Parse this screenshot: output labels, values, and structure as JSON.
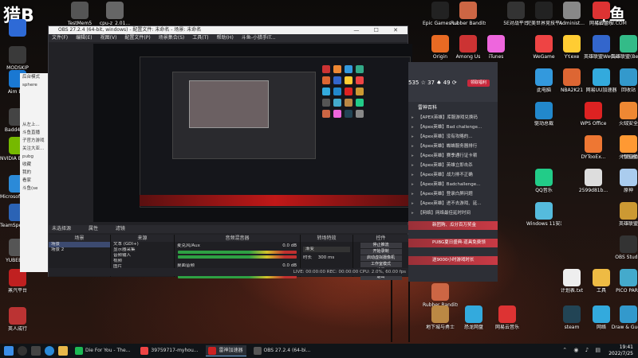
{
  "watermark": {
    "left": "猎B",
    "right": "斗鱼",
    "right_sub": "DOUYU.COM"
  },
  "left_icons_col1": [
    {
      "label": "",
      "color": "#2e6ad6"
    },
    {
      "label": "MODSKIP",
      "color": "#3a3a3a"
    },
    {
      "label": "Aim Lab",
      "color": "#1a78d2"
    },
    {
      "label": "Badd4Ko...",
      "color": "#444"
    },
    {
      "label": "NVIDIA Broadcast",
      "color": "#76b900"
    },
    {
      "label": "Microsoft Edge",
      "color": "#2b8ad8"
    },
    {
      "label": "TeamSpeak 3 Client",
      "color": "#2b63b5"
    },
    {
      "label": "YUBEBR...",
      "color": "#555"
    },
    {
      "label": "蒸汽平台",
      "color": "#c02020"
    },
    {
      "label": "英人成行",
      "color": "#b33"
    }
  ],
  "top_icons": [
    {
      "label": "TestMem5",
      "color": "#555"
    },
    {
      "label": "cpu-z_2.01...",
      "color": "#666"
    }
  ],
  "right_top_icons": [
    {
      "label": "Epic Games Launcher",
      "color": "#222"
    },
    {
      "label": "Rubber Bandits...",
      "color": "#c64"
    },
    {
      "label": "5E对战平台",
      "color": "#333"
    },
    {
      "label": "完美世界竞技平台",
      "color": "#222"
    },
    {
      "label": "Administ...",
      "color": "#888"
    },
    {
      "label": "网易云音乐",
      "color": "#d33"
    },
    {
      "label": "Origin",
      "color": "#e86a23"
    },
    {
      "label": "Among Us",
      "color": "#c33"
    },
    {
      "label": "iTunes",
      "color": "#e6d"
    },
    {
      "label": "WeGame",
      "color": "#e44"
    },
    {
      "label": "YY.exe",
      "color": "#fc3"
    },
    {
      "label": "英雄联盟WeGame版",
      "color": "#36c"
    },
    {
      "label": "英雄联盟(Beta版)",
      "color": "#3b8"
    },
    {
      "label": "此电脑",
      "color": "#39d"
    },
    {
      "label": "NBA2K21",
      "color": "#d63"
    },
    {
      "label": "网易UU加速器",
      "color": "#3ad"
    },
    {
      "label": "回收站",
      "color": "#39c"
    },
    {
      "label": "驱动总裁",
      "color": "#28c"
    },
    {
      "label": "WPS Office",
      "color": "#d22"
    },
    {
      "label": "火绒安全",
      "color": "#e83"
    },
    {
      "label": "火星直播",
      "color": "#d44"
    },
    {
      "label": "DYTooEx...",
      "color": "#e73"
    },
    {
      "label": "代练通",
      "color": "#f93"
    },
    {
      "label": "QQ音乐",
      "color": "#2c8"
    },
    {
      "label": "2599d81b...",
      "color": "#ddd"
    },
    {
      "label": "原神",
      "color": "#ace"
    },
    {
      "label": "Windows 11安装...",
      "color": "#5bd"
    },
    {
      "label": "英雄联盟",
      "color": "#c93"
    },
    {
      "label": "OBS Studio",
      "color": "#333"
    },
    {
      "label": "计划表.txt",
      "color": "#eee"
    },
    {
      "label": "工具",
      "color": "#eb4"
    },
    {
      "label": "PICO PARK",
      "color": "#4ac"
    },
    {
      "label": "steam",
      "color": "#245"
    },
    {
      "label": "网络",
      "color": "#3ad"
    },
    {
      "label": "Draw & Guess",
      "color": "#39c"
    },
    {
      "label": "Rubber Bandits...",
      "color": "#c64"
    },
    {
      "label": "地下城与勇士",
      "color": "#b84"
    },
    {
      "label": "恐龙网盘",
      "color": "#3ad"
    },
    {
      "label": "网易云音乐",
      "color": "#d33"
    }
  ],
  "left_app": {
    "rows": [
      "后台模式",
      "sphere",
      "",
      "",
      "",
      "",
      "从左上...",
      "斗鱼直播",
      "子官方游戏",
      "关注大亚...",
      "pubg",
      "收藏",
      "我的",
      "看家",
      "斗鱼(se"
    ]
  },
  "obs": {
    "title": "OBS 27.2.4 (64-bit, windows) - 配置文件: 未命名 - 场景: 未命名",
    "menu": [
      "文件(F)",
      "编辑(E)",
      "视图(V)",
      "配置文件(P)",
      "场景集合(S)",
      "工具(T)",
      "帮助(H)",
      "斗鱼-小猎手IT..."
    ],
    "toolbar": {
      "label": "未选择源",
      "props": "属性",
      "filters": "滤镜"
    },
    "dock_heads": [
      "场景",
      "来源",
      "音频混音器",
      "转场特效",
      "控件"
    ],
    "scenes": [
      "场景",
      "场景 2"
    ],
    "sources": [
      "文本 (GDI+)",
      "显示器采集",
      "音频输入",
      "视频",
      "图片"
    ],
    "mixer": [
      {
        "name": "麦克风/Aux",
        "level": "0.0 dB"
      },
      {
        "name": "桌面音频",
        "level": "0.0 dB"
      }
    ],
    "transition": {
      "type": "渐变",
      "duration_label": "时长",
      "duration": "300 ms"
    },
    "controls": [
      "停止推流",
      "开始录制",
      "启动虚拟摄像机",
      "工作室模式",
      "设置",
      "退出"
    ],
    "status": "LIVE: 00:00:00   REC: 00:00:00   CPU: 2.0%, 60.00 fps"
  },
  "panel": {
    "stats": "535 ☆ 37 ♠ 49 ⟳",
    "button": "领取福利",
    "head": "雷神百科",
    "items": [
      "【APEX英雄】库服游戏兑换码",
      "【Apex英雄】Bad challenge...",
      "【Apex英雄】没有攻略的...",
      "【Apex英雄】蜘蛛服务器排行",
      "【Apex英雄】赛季通行证卡顿",
      "【Apex英雄】英雄立即击杀",
      "【Apex英雄】战力排不正确",
      "【Apex英雄】Badchallenge...",
      "【Apex英雄】登录白屏问题",
      "【Apex英雄】进不去游戏、延...",
      "【网络】网络最佳延时时间"
    ],
    "promos": [
      "新团购、瓜分百万奖金",
      "PUBG夏日盛典-道具免费领",
      "送9000小时游戏时长"
    ]
  },
  "taskbar": {
    "apps": [
      {
        "label": "Die For You - The...",
        "color": "#1db954",
        "active": false
      },
      {
        "label": "39759717-myhou...",
        "color": "#e44",
        "active": false
      },
      {
        "label": "雷神加速器",
        "color": "#c22",
        "active": true
      },
      {
        "label": "OBS 27.2.4 (64-bi...",
        "color": "#555",
        "active": false
      }
    ],
    "time": "19:41",
    "date": "2022/7/25"
  }
}
